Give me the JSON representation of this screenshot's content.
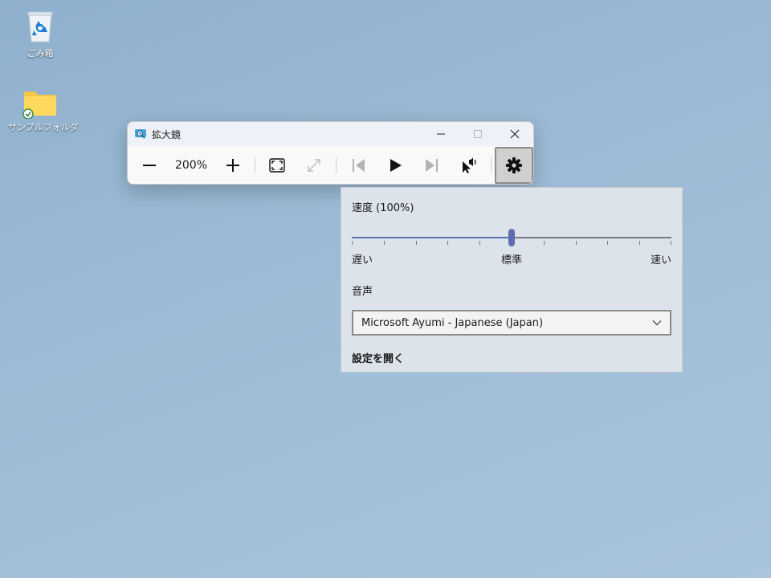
{
  "desktop": {
    "icons": [
      {
        "label": "ごみ箱",
        "icon": "recycle-bin-icon"
      },
      {
        "label": "サンプルフォルダ",
        "icon": "folder-icon"
      }
    ]
  },
  "magnifier": {
    "title": "拡大鏡",
    "zoom_level": "200%",
    "toolbar": [
      "zoom-out-icon",
      "zoom-in-icon",
      "view-fullscreen-icon",
      "expand-icon",
      "previous-icon",
      "play-icon",
      "next-icon",
      "read-from-pointer-icon",
      "settings-gear-icon"
    ]
  },
  "settings_flyout": {
    "speed_label": "速度 (100%)",
    "speed_value": 50,
    "speed_ticks": 11,
    "slow_label": "遅い",
    "normal_label": "標準",
    "fast_label": "速い",
    "voice_label": "音声",
    "voice_selected": "Microsoft Ayumi - Japanese (Japan)",
    "open_settings_label": "設定を開く"
  },
  "colors": {
    "accent": "#5e6fb0",
    "desktop_bg": "#9dbbd6",
    "flyout_bg": "#dde3ea"
  }
}
